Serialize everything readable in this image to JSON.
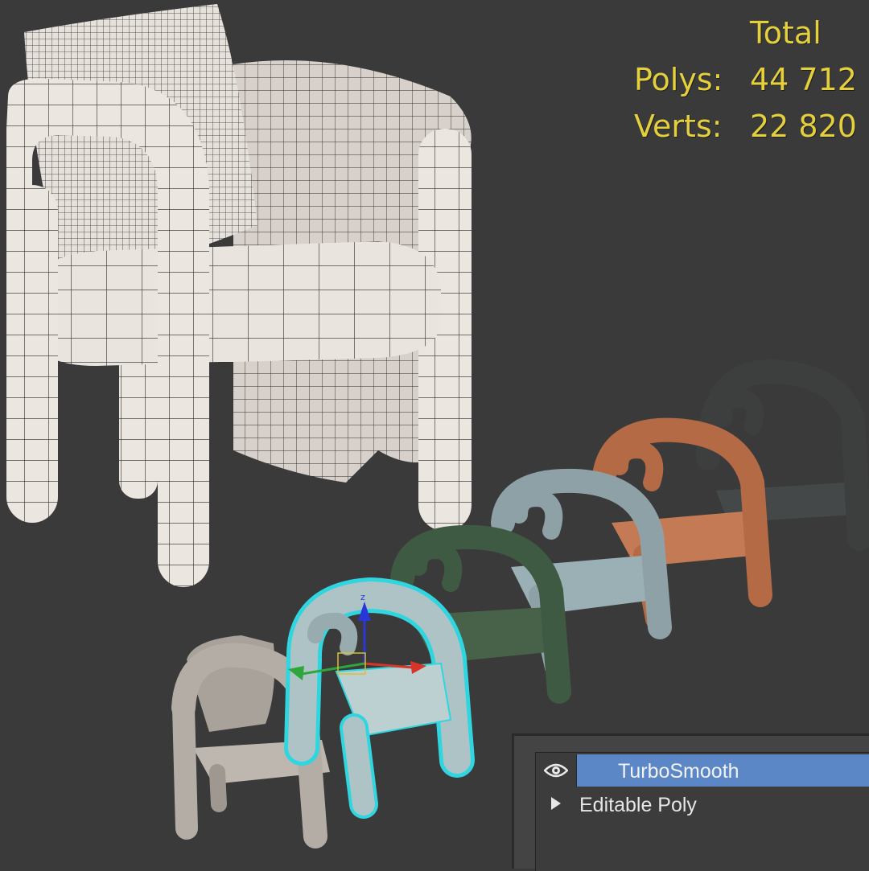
{
  "stats": {
    "total_label": "Total",
    "polys_label": "Polys:",
    "polys_value": "44 712",
    "verts_label": "Verts:",
    "verts_value": "22 820",
    "text_color": "#e4cf3c"
  },
  "modifier_stack": {
    "items": [
      {
        "label": "TurboSmooth",
        "icon": "eye-icon",
        "selected": true
      },
      {
        "label": "Editable Poly",
        "icon": "expand-arrow-icon",
        "selected": false
      }
    ],
    "selection_color": "#5b87c6"
  },
  "viewport": {
    "background": "#3a3a3a",
    "selection_outline_color": "#2fd6e0",
    "gizmo_icon": "move-gizmo-icon",
    "chairs": [
      {
        "name": "wireframe-chair",
        "color": "#e9e3de"
      },
      {
        "name": "beige-chair",
        "color": "#b3ada6"
      },
      {
        "name": "pale-blue-chair",
        "color": "#a9bcc0"
      },
      {
        "name": "green-chair",
        "color": "#3f5a43"
      },
      {
        "name": "grey-blue-chair",
        "color": "#8ea1a6"
      },
      {
        "name": "terracotta-chair",
        "color": "#b46a45"
      },
      {
        "name": "charcoal-chair",
        "color": "#3c3f3e"
      }
    ]
  }
}
